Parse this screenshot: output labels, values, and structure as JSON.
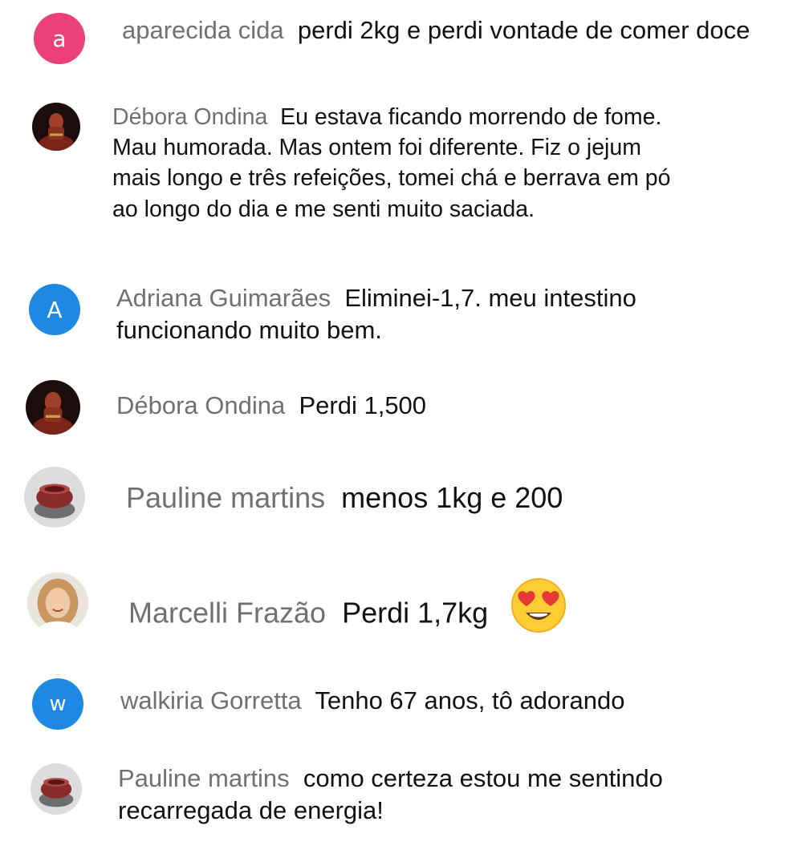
{
  "comments": [
    {
      "author": "aparecida cida",
      "text": "perdi 2kg e perdi vontade de comer doce",
      "avatar_letter": "a",
      "avatar_color": "#ec407a",
      "avatar_icon": "letter-avatar"
    },
    {
      "author": "Débora Ondina",
      "text": "Eu estava ficando morrendo de fome. Mau humorada. Mas ontem foi diferente. Fiz o jejum mais longo e três refeições, tomei chá e berrava em pó ao longo do dia e me senti muito saciada.",
      "avatar_icon": "photo-avatar-dark"
    },
    {
      "author": "Adriana Guimarães",
      "text": "Eliminei-1,7. meu intestino funcionando muito bem.",
      "avatar_letter": "A",
      "avatar_color": "#1e88e5",
      "avatar_icon": "letter-avatar"
    },
    {
      "author": "Débora Ondina",
      "text": "Perdi 1,500",
      "avatar_icon": "photo-avatar-dark"
    },
    {
      "author": "Pauline martins",
      "text": "menos 1kg e 200",
      "avatar_icon": "photo-avatar-bowl"
    },
    {
      "author": "Marcelli Frazão",
      "text": "Perdi 1,7kg",
      "emoji": "heart-eyes-emoji",
      "avatar_icon": "photo-avatar-woman"
    },
    {
      "author": "walkiria Gorretta",
      "text": "Tenho 67 anos, tô adorando",
      "avatar_letter": "w",
      "avatar_color": "#1e88e5",
      "avatar_icon": "letter-avatar"
    },
    {
      "author": "Pauline martins",
      "text": "como certeza estou me sentindo recarregada de energia!",
      "avatar_icon": "photo-avatar-bowl"
    }
  ]
}
